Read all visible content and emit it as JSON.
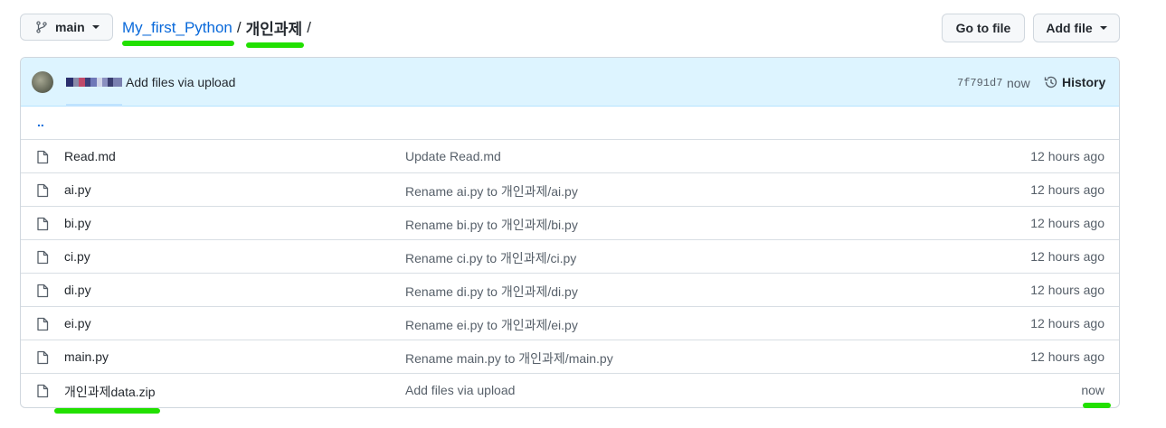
{
  "branch": {
    "label": "main",
    "icon": "git-branch-icon"
  },
  "breadcrumb": {
    "repo": "My_first_Python",
    "sep1": "/",
    "folder": "개인과제",
    "sep2": "/"
  },
  "toolbar": {
    "goto_label": "Go to file",
    "addfile_label": "Add file"
  },
  "commit": {
    "message": "Add files via upload",
    "sha": "7f791d7",
    "time": "now",
    "history_label": "History"
  },
  "updir": {
    "label": ".."
  },
  "files": [
    {
      "name": "Read.md",
      "message": "Update Read.md",
      "time": "12 hours ago"
    },
    {
      "name": "ai.py",
      "message": "Rename ai.py to 개인과제/ai.py",
      "time": "12 hours ago"
    },
    {
      "name": "bi.py",
      "message": "Rename bi.py to 개인과제/bi.py",
      "time": "12 hours ago"
    },
    {
      "name": "ci.py",
      "message": "Rename ci.py to 개인과제/ci.py",
      "time": "12 hours ago"
    },
    {
      "name": "di.py",
      "message": "Rename di.py to 개인과제/di.py",
      "time": "12 hours ago"
    },
    {
      "name": "ei.py",
      "message": "Rename ei.py to 개인과제/ei.py",
      "time": "12 hours ago"
    },
    {
      "name": "main.py",
      "message": "Rename main.py to 개인과제/main.py",
      "time": "12 hours ago"
    },
    {
      "name": "개인과제data.zip",
      "message": "Add files via upload",
      "time": "now"
    }
  ],
  "colors": {
    "link": "#0969da",
    "highlight": "#22e000",
    "commit_bg": "#ddf4ff"
  }
}
